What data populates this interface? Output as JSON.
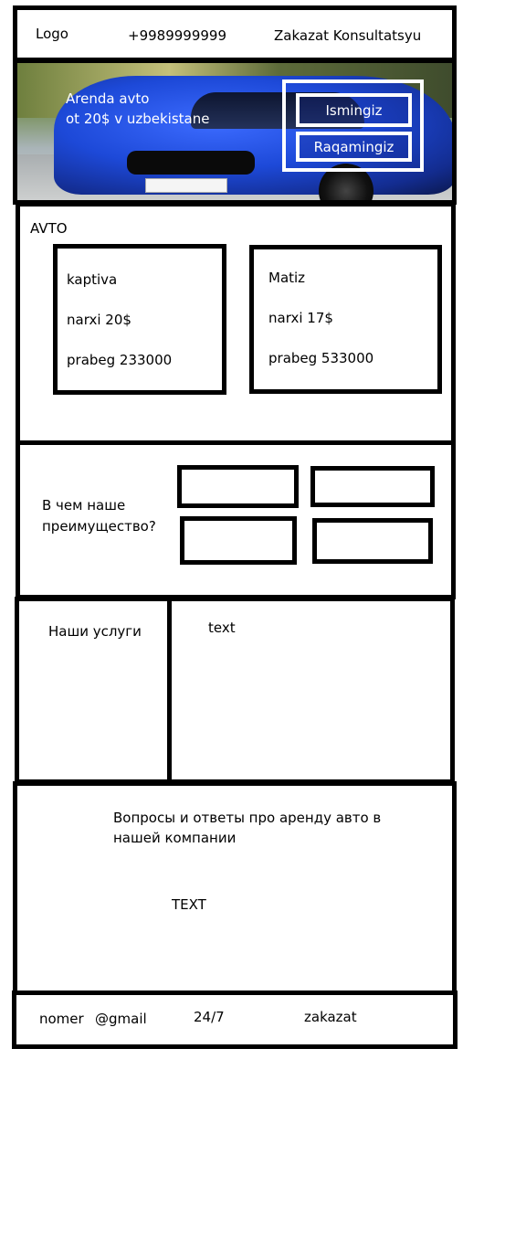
{
  "header": {
    "logo": "Logo",
    "phone": "+9989999999",
    "order_link": "Zakazat Konsultatsyu"
  },
  "hero": {
    "line1": "Arenda avto",
    "line2": "ot 20$ v uzbekistane",
    "name_placeholder": "Ismingiz",
    "phone_placeholder": "Raqamingiz"
  },
  "avto": {
    "title": "AVTO",
    "cards": [
      {
        "name": "kaptiva",
        "price": "narxi 20$",
        "mileage": "prabeg 233000"
      },
      {
        "name": "Matiz",
        "price": "narxi 17$",
        "mileage": "prabeg 533000"
      }
    ]
  },
  "advantages": {
    "title_line1": "В чем наше",
    "title_line2": "преимущество?"
  },
  "services": {
    "title": "Наши услуги",
    "text": "text"
  },
  "faq": {
    "title_line1": "Вопросы и ответы про аренду авто в",
    "title_line2": "нашей компании",
    "text": "TEXT"
  },
  "footer": {
    "phone": "nomer",
    "email": "@gmail",
    "hours": "24/7",
    "order": "zakazat"
  },
  "colors": {
    "border": "#000000",
    "hero_text": "#ffffff",
    "car_blue": "#1d49d8"
  }
}
